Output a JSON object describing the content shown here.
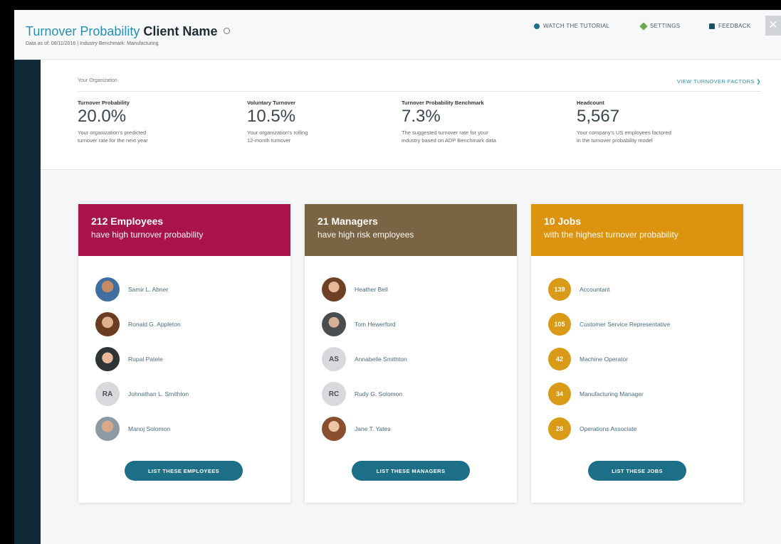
{
  "header": {
    "title_part1": "Turnover Probability",
    "title_part2": "Client Name",
    "subtitle": "Data as of: 08/11/2016  |  Industry Benchmark: Manufacturing",
    "links": {
      "tutorial": "WATCH THE TUTORIAL",
      "settings": "SETTINGS",
      "feedback": "FEEDBACK"
    },
    "close": "✕"
  },
  "organization": {
    "label": "Your Organization",
    "factors_link": "VIEW TURNOVER FACTORS ❯",
    "metrics": [
      {
        "label": "Turnover Probability",
        "value": "20.0%",
        "desc1": "Your organization's predicted",
        "desc2": "turnover rate for the next year"
      },
      {
        "label": "Voluntary Turnover",
        "value": "10.5%",
        "desc1": "Your organization's rolling",
        "desc2": "12-month turnover"
      },
      {
        "label": "Turnover Probability Benchmark",
        "value": "7.3%",
        "desc1": "The suggested turnover rate for your",
        "desc2": "industry based on ADP Benchmark data"
      },
      {
        "label": "Headcount",
        "value": "5,567",
        "desc1": "Your company's US employees factored",
        "desc2": "in the turnover probability model"
      }
    ]
  },
  "cards": {
    "employees": {
      "title": "212 Employees",
      "subtitle": "have high turnover probability",
      "color": "#a8134a",
      "items": [
        {
          "name": "Samir L. Abner",
          "initials": ""
        },
        {
          "name": "Ronald G. Appleton",
          "initials": ""
        },
        {
          "name": "Rupal Patele",
          "initials": ""
        },
        {
          "name": "Johnathan L. Smithton",
          "initials": "RA"
        },
        {
          "name": "Manoj Solomon",
          "initials": ""
        }
      ],
      "button": "LIST THESE EMPLOYEES"
    },
    "managers": {
      "title": "21 Managers",
      "subtitle": "have high risk employees",
      "color": "#7b6444",
      "items": [
        {
          "name": "Heather Bell",
          "initials": ""
        },
        {
          "name": "Tom Hewerford",
          "initials": ""
        },
        {
          "name": "Annabelle Smithton",
          "initials": "AS"
        },
        {
          "name": "Rudy G. Solomon",
          "initials": "RC"
        },
        {
          "name": "Jane T. Yates",
          "initials": ""
        }
      ],
      "button": "LIST THESE MANAGERS"
    },
    "jobs": {
      "title": "10 Jobs",
      "subtitle": "with the highest turnover probability",
      "color": "#dc9310",
      "items": [
        {
          "count": "139",
          "name": "Accountant"
        },
        {
          "count": "105",
          "name": "Customer Service Representative"
        },
        {
          "count": "42",
          "name": "Machine Operator"
        },
        {
          "count": "34",
          "name": "Manufacturing Manager"
        },
        {
          "count": "28",
          "name": "Operations Associate"
        }
      ],
      "button": "LIST THESE JOBS"
    }
  }
}
